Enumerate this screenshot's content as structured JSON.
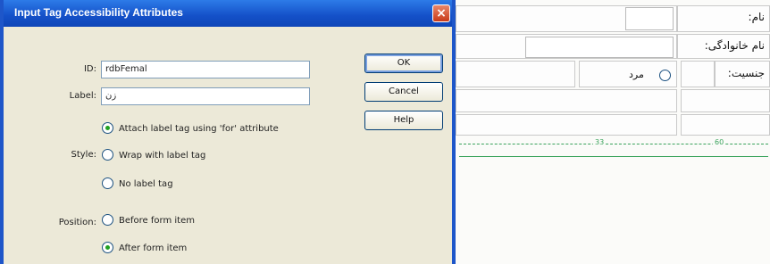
{
  "dialog": {
    "title": "Input Tag Accessibility Attributes",
    "close_glyph": "×",
    "id_label": "ID:",
    "id_value": "rdbFemal",
    "label_label": "Label:",
    "label_value": "زن",
    "style_label": "Style:",
    "position_label": "Position:",
    "style_options": [
      {
        "label": "Attach label tag using 'for' attribute",
        "checked": true
      },
      {
        "label": "Wrap with label tag",
        "checked": false
      },
      {
        "label": "No label tag",
        "checked": false
      }
    ],
    "position_options": [
      {
        "label": "Before form item",
        "checked": false
      },
      {
        "label": "After form item",
        "checked": true
      }
    ],
    "buttons": {
      "ok": "OK",
      "cancel": "Cancel",
      "help": "Help"
    }
  },
  "design_view": {
    "name_label": "نام:",
    "family_label": "نام خانوادگی:",
    "gender_label": "جنسیت:",
    "male_option": "مرد",
    "ruler_left": "33",
    "ruler_right": "60"
  },
  "colors": {
    "titlebar": "#1450c8",
    "dialog_bg": "#ece9d8",
    "guide_green": "#3aa35c"
  }
}
